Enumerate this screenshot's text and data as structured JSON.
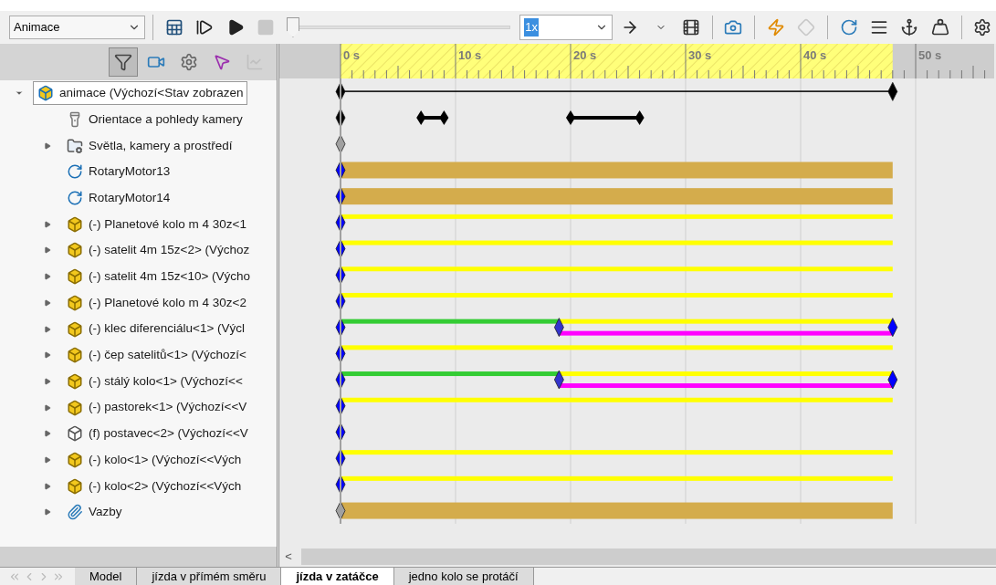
{
  "toolbar": {
    "study_type": "Animace",
    "buttons": [
      {
        "kind": "calc",
        "disabled": false
      },
      {
        "kind": "play-start",
        "disabled": false
      },
      {
        "kind": "play",
        "disabled": false
      },
      {
        "kind": "stop",
        "disabled": true
      }
    ],
    "timeline_slider": {
      "level": 0
    },
    "speed": "1x",
    "tools": [
      {
        "kind": "arrow",
        "disabled": false
      },
      {
        "kind": "caret",
        "disabled": false
      },
      {
        "kind": "film-save",
        "disabled": false
      },
      {
        "kind": "sep"
      },
      {
        "kind": "camera",
        "disabled": false
      },
      {
        "kind": "sep"
      },
      {
        "kind": "key-bolt",
        "disabled": false
      },
      {
        "kind": "key-add",
        "disabled": true
      },
      {
        "kind": "sep"
      },
      {
        "kind": "motor",
        "disabled": false
      },
      {
        "kind": "spring",
        "disabled": false
      },
      {
        "kind": "contact",
        "disabled": false
      },
      {
        "kind": "gravity",
        "disabled": false
      },
      {
        "kind": "sep"
      },
      {
        "kind": "gear",
        "disabled": false
      }
    ]
  },
  "filters": [
    {
      "kind": "filter",
      "selected": true,
      "disabled": false
    },
    {
      "kind": "camera-filter",
      "selected": false,
      "disabled": false
    },
    {
      "kind": "gear-filter",
      "selected": false,
      "disabled": false
    },
    {
      "kind": "pointer-filter",
      "selected": false,
      "disabled": false
    },
    {
      "kind": "chart-filter",
      "selected": false,
      "disabled": true
    }
  ],
  "tree": {
    "label": "animace  (Výchozí<Stav zobrazen",
    "kind": "assembly",
    "expanded": true,
    "selected": true,
    "children": [
      {
        "label": "Orientace a pohledy kamery",
        "kind": "flashlight",
        "expandable": false
      },
      {
        "label": "Světla, kamery a prostředí",
        "kind": "folder",
        "expandable": true
      },
      {
        "label": "RotaryMotor13",
        "kind": "motor",
        "expandable": false
      },
      {
        "label": "RotaryMotor14",
        "kind": "motor",
        "expandable": false
      },
      {
        "label": "(-) Planetové kolo m 4 30z<1",
        "kind": "part",
        "expandable": true
      },
      {
        "label": "(-) satelit 4m 15z<2> (Výchoz",
        "kind": "part",
        "expandable": true
      },
      {
        "label": "(-) satelit 4m 15z<10> (Výcho",
        "kind": "part",
        "expandable": true
      },
      {
        "label": "(-) Planetové kolo m 4 30z<2",
        "kind": "part",
        "expandable": true
      },
      {
        "label": "(-) klec diferenciálu<1> (Výcl",
        "kind": "part",
        "expandable": true
      },
      {
        "label": "(-) čep satelitů<1> (Výchozí<",
        "kind": "part",
        "expandable": true
      },
      {
        "label": "(-) stálý kolo<1> (Výchozí<<",
        "kind": "part",
        "expandable": true
      },
      {
        "label": "(-) pastorek<1> (Výchozí<<V",
        "kind": "part",
        "expandable": true
      },
      {
        "label": "(f) postavec<2> (Výchozí<<V",
        "kind": "part-fixed",
        "expandable": true
      },
      {
        "label": "(-) kolo<1> (Výchozí<<Vých",
        "kind": "part",
        "expandable": true
      },
      {
        "label": "(-) kolo<2> (Výchozí<<Vých",
        "kind": "part",
        "expandable": true
      },
      {
        "label": "Vazby",
        "kind": "mates",
        "expandable": true
      }
    ]
  },
  "timeline": {
    "ticks": [
      "0 s",
      "10 s",
      "20 s",
      "30 s",
      "40 s",
      "50 s"
    ],
    "rows": [
      {
        "kind": "range"
      },
      {
        "kind": "camera"
      },
      {
        "kind": "inactive"
      },
      {
        "kind": "motor"
      },
      {
        "kind": "motor"
      },
      {
        "kind": "motion"
      },
      {
        "kind": "motion"
      },
      {
        "kind": "motion"
      },
      {
        "kind": "motion"
      },
      {
        "kind": "change"
      },
      {
        "kind": "motion"
      },
      {
        "kind": "change"
      },
      {
        "kind": "motion"
      },
      {
        "kind": "key"
      },
      {
        "kind": "motion"
      },
      {
        "kind": "motion"
      },
      {
        "kind": "mates"
      }
    ]
  },
  "scroll_left": "<",
  "tabs": [
    {
      "label": "Model",
      "selected": false
    },
    {
      "label": "jízda v přímém směru",
      "selected": false
    },
    {
      "label": "jízda v zatáčce",
      "selected": true
    },
    {
      "label": "jedno kolo se protáčí",
      "selected": false
    }
  ]
}
